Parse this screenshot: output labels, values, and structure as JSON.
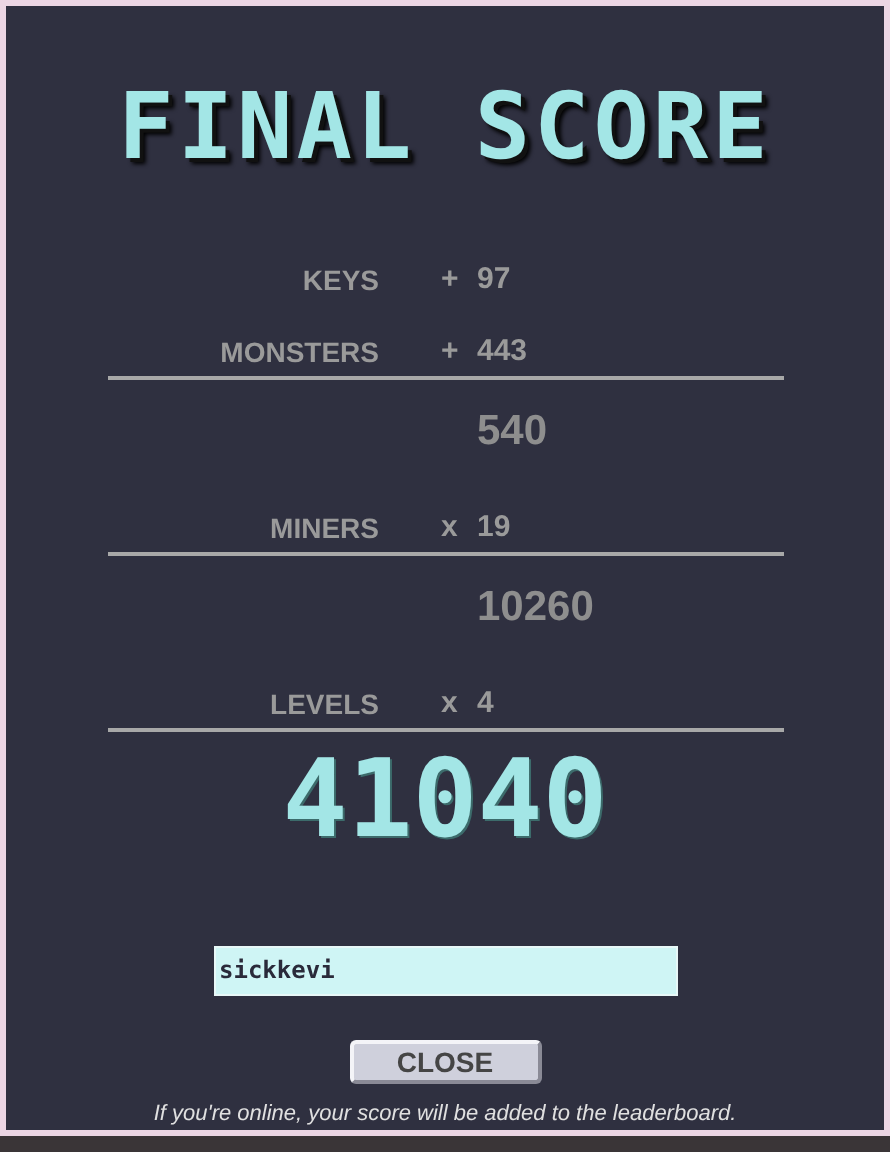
{
  "title": "FINAL SCORE",
  "lines": [
    {
      "kind": "term",
      "label": "KEYS",
      "operator": "+",
      "value": "97",
      "underlined": false
    },
    {
      "kind": "term",
      "label": "MONSTERS",
      "operator": "+",
      "value": "443",
      "underlined": true
    },
    {
      "kind": "subtotal",
      "value": "540"
    },
    {
      "kind": "term",
      "label": "MINERS",
      "operator": "x",
      "value": "19",
      "underlined": true
    },
    {
      "kind": "subtotal",
      "value": "10260"
    },
    {
      "kind": "term",
      "label": "LEVELS",
      "operator": "x",
      "value": "4",
      "underlined": true
    }
  ],
  "total": "41040",
  "name_field": {
    "value": "sickkevi"
  },
  "buttons": [
    "CLOSE"
  ],
  "footer": "If you're online, your score will be added to the leaderboard."
}
